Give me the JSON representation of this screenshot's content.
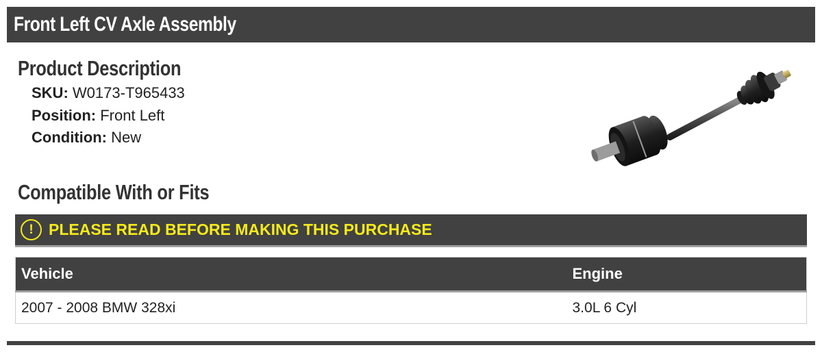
{
  "header": {
    "title": "Front Left CV Axle Assembly"
  },
  "description": {
    "heading": "Product Description",
    "specs": [
      {
        "label": "SKU:",
        "value": "W0173-T965433"
      },
      {
        "label": "Position:",
        "value": "Front Left"
      },
      {
        "label": "Condition:",
        "value": "New"
      }
    ]
  },
  "compatibility": {
    "heading": "Compatible With or Fits",
    "warning": "PLEASE READ BEFORE MAKING THIS PURCHASE",
    "warning_icon": "exclamation-circle-icon",
    "warning_symbol": "!",
    "columns": [
      "Vehicle",
      "Engine"
    ],
    "rows": [
      {
        "vehicle": "2007 - 2008 BMW 328xi",
        "engine": "3.0L 6 Cyl"
      }
    ]
  },
  "colors": {
    "bar": "#414141",
    "warning": "#f5ea1a",
    "divider": "#9e9e9e"
  }
}
